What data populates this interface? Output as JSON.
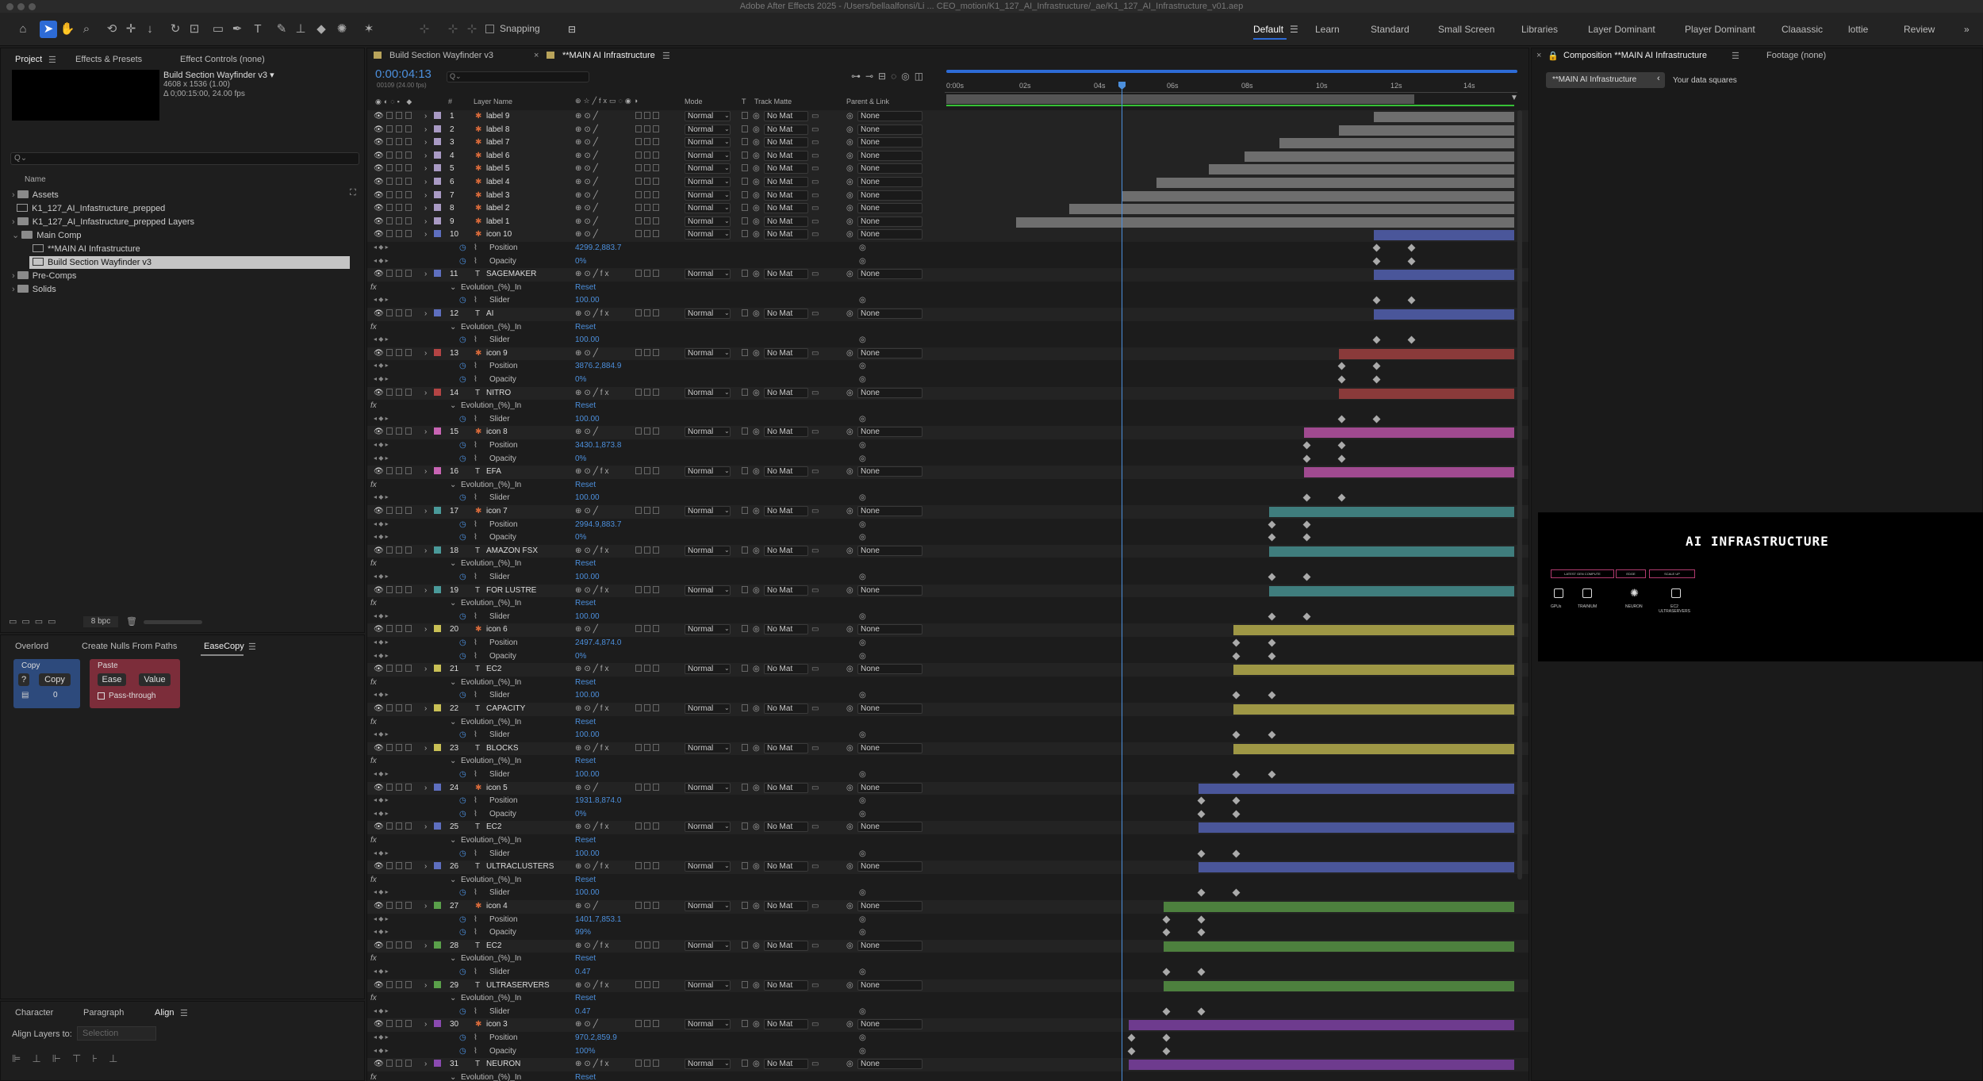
{
  "app": {
    "title": "Adobe After Effects 2025 - /Users/bellaalfonsi/Li ... CEO_motion/K1_127_AI_Infrastructure/_ae/K1_127_AI_Infrastructure_v01.aep",
    "snapping": "Snapping"
  },
  "workspaces": [
    "Default",
    "Learn",
    "Standard",
    "Small Screen",
    "Libraries",
    "Layer Dominant",
    "Player Dominant",
    "Claaassic",
    "lottie",
    "Review"
  ],
  "project": {
    "tabs": [
      "Project",
      "Effects & Presets",
      "Effect Controls (none)"
    ],
    "selected_name": "Build Section Wayfinder v3 ▾",
    "selected_info1": "4608 x 1536 (1.00)",
    "selected_info2": "Δ 0;00:15:00, 24.00 fps",
    "search_placeholder": "Q⌄",
    "name_header": "Name",
    "items": [
      "Assets",
      "K1_127_AI_Infastructure_prepped",
      "K1_127_AI_Infastructure_prepped Layers",
      "Main Comp",
      "**MAIN AI Infrastructure",
      "Build Section Wayfinder v3",
      "Pre-Comps",
      "Solids"
    ],
    "bpc": "8 bpc"
  },
  "scripts": {
    "tabs": [
      "Overlord",
      "Create Nulls From Paths",
      "EaseCopy"
    ],
    "copy_label": "Copy",
    "paste_label": "Paste",
    "q": "?",
    "copy_btn": "Copy",
    "ease_btn": "Ease",
    "value_btn": "Value",
    "count": "0",
    "passthrough": "Pass-through"
  },
  "align": {
    "tabs": [
      "Character",
      "Paragraph",
      "Align"
    ],
    "label": "Align Layers to:",
    "select": "Selection"
  },
  "timeline": {
    "tabs": [
      "Build Section Wayfinder v3",
      "**MAIN AI Infrastructure"
    ],
    "timecode": "0:00:04:13",
    "frames": "00109 (24.00 fps)",
    "headers": {
      "num": "#",
      "name": "Layer Name",
      "mode": "Mode",
      "t": "T",
      "matte": "Track Matte",
      "parent": "Parent & Link"
    },
    "ruler": [
      "0:00s",
      "02s",
      "04s",
      "06s",
      "08s",
      "10s",
      "12s",
      "14s"
    ],
    "rows": [
      {
        "t": "L",
        "n": "1",
        "name": "label 9",
        "c": "#a99ac4",
        "s": 1.22,
        "mode": "Normal",
        "matte": "No Mat",
        "parent": "None",
        "bar": "#6e6e6e"
      },
      {
        "t": "L",
        "n": "2",
        "name": "label 8",
        "c": "#a99ac4",
        "s": 1.12,
        "mode": "Normal",
        "matte": "No Mat",
        "parent": "None",
        "bar": "#6e6e6e"
      },
      {
        "t": "L",
        "n": "3",
        "name": "label 7",
        "c": "#a99ac4",
        "s": 0.95,
        "mode": "Normal",
        "matte": "No Mat",
        "parent": "None",
        "bar": "#6e6e6e"
      },
      {
        "t": "L",
        "n": "4",
        "name": "label 6",
        "c": "#a99ac4",
        "s": 0.85,
        "mode": "Normal",
        "matte": "No Mat",
        "parent": "None",
        "bar": "#6e6e6e"
      },
      {
        "t": "L",
        "n": "5",
        "name": "label 5",
        "c": "#a99ac4",
        "s": 0.75,
        "mode": "Normal",
        "matte": "No Mat",
        "parent": "None",
        "bar": "#6e6e6e"
      },
      {
        "t": "L",
        "n": "6",
        "name": "label 4",
        "c": "#a99ac4",
        "s": 0.6,
        "mode": "Normal",
        "matte": "No Mat",
        "parent": "None",
        "bar": "#6e6e6e"
      },
      {
        "t": "L",
        "n": "7",
        "name": "label 3",
        "c": "#a99ac4",
        "s": 0.5,
        "mode": "Normal",
        "matte": "No Mat",
        "parent": "None",
        "bar": "#6e6e6e"
      },
      {
        "t": "L",
        "n": "8",
        "name": "label 2",
        "c": "#a99ac4",
        "s": 0.35,
        "mode": "Normal",
        "matte": "No Mat",
        "parent": "None",
        "bar": "#6e6e6e"
      },
      {
        "t": "L",
        "n": "9",
        "name": "label 1",
        "c": "#a99ac4",
        "s": 0.2,
        "mode": "Normal",
        "matte": "No Mat",
        "parent": "None",
        "bar": "#6e6e6e"
      },
      {
        "t": "L",
        "n": "10",
        "name": "icon 10",
        "c": "#5e6fbf",
        "s": 1.22,
        "mode": "Normal",
        "matte": "No Mat",
        "parent": "None",
        "bar": "#4a569a"
      },
      {
        "t": "P",
        "name": "Position",
        "val": "4299.2,883.7",
        "k": [
          1.22,
          1.32
        ]
      },
      {
        "t": "P",
        "name": "Opacity",
        "val": "0%",
        "k": [
          1.22,
          1.32
        ]
      },
      {
        "t": "L",
        "n": "11",
        "name": "SAGEMAKER",
        "c": "#5e6fbf",
        "s": 1.22,
        "mode": "Normal",
        "matte": "No Mat",
        "parent": "None",
        "bar": "#4a569a",
        "tx": 1
      },
      {
        "t": "E",
        "name": "Evolution_(%)_In",
        "val": "Reset"
      },
      {
        "t": "P",
        "name": "Slider",
        "val": "100.00",
        "k": [
          1.22,
          1.32
        ]
      },
      {
        "t": "L",
        "n": "12",
        "name": "AI",
        "c": "#5e6fbf",
        "s": 1.22,
        "mode": "Normal",
        "matte": "No Mat",
        "parent": "None",
        "bar": "#4a569a",
        "tx": 1
      },
      {
        "t": "E",
        "name": "Evolution_(%)_In",
        "val": "Reset"
      },
      {
        "t": "P",
        "name": "Slider",
        "val": "100.00",
        "k": [
          1.22,
          1.32
        ]
      },
      {
        "t": "L",
        "n": "13",
        "name": "icon 9",
        "c": "#b34444",
        "s": 1.12,
        "mode": "Normal",
        "matte": "No Mat",
        "parent": "None",
        "bar": "#8a3a3a"
      },
      {
        "t": "P",
        "name": "Position",
        "val": "3876.2,884.9",
        "k": [
          1.12,
          1.22
        ]
      },
      {
        "t": "P",
        "name": "Opacity",
        "val": "0%",
        "k": [
          1.12,
          1.22
        ]
      },
      {
        "t": "L",
        "n": "14",
        "name": "NITRO",
        "c": "#b34444",
        "s": 1.12,
        "mode": "Normal",
        "matte": "No Mat",
        "parent": "None",
        "bar": "#8a3a3a",
        "tx": 1
      },
      {
        "t": "E",
        "name": "Evolution_(%)_In",
        "val": "Reset"
      },
      {
        "t": "P",
        "name": "Slider",
        "val": "100.00",
        "k": [
          1.12,
          1.22
        ]
      },
      {
        "t": "L",
        "n": "15",
        "name": "icon 8",
        "c": "#c864b4",
        "s": 1.02,
        "mode": "Normal",
        "matte": "No Mat",
        "parent": "None",
        "bar": "#a04a90"
      },
      {
        "t": "P",
        "name": "Position",
        "val": "3430.1,873.8",
        "k": [
          1.02,
          1.12
        ]
      },
      {
        "t": "P",
        "name": "Opacity",
        "val": "0%",
        "k": [
          1.02,
          1.12
        ]
      },
      {
        "t": "L",
        "n": "16",
        "name": "EFA",
        "c": "#c864b4",
        "s": 1.02,
        "mode": "Normal",
        "matte": "No Mat",
        "parent": "None",
        "bar": "#a04a90",
        "tx": 1
      },
      {
        "t": "E",
        "name": "Evolution_(%)_In",
        "val": "Reset"
      },
      {
        "t": "P",
        "name": "Slider",
        "val": "100.00",
        "k": [
          1.02,
          1.12
        ]
      },
      {
        "t": "L",
        "n": "17",
        "name": "icon 7",
        "c": "#4a9a9a",
        "s": 0.92,
        "mode": "Normal",
        "matte": "No Mat",
        "parent": "None",
        "bar": "#3f7d7d"
      },
      {
        "t": "P",
        "name": "Position",
        "val": "2994.9,883.7",
        "k": [
          0.92,
          1.02
        ]
      },
      {
        "t": "P",
        "name": "Opacity",
        "val": "0%",
        "k": [
          0.92,
          1.02
        ]
      },
      {
        "t": "L",
        "n": "18",
        "name": "AMAZON FSX",
        "c": "#4a9a9a",
        "s": 0.92,
        "mode": "Normal",
        "matte": "No Mat",
        "parent": "None",
        "bar": "#3f7d7d",
        "tx": 1
      },
      {
        "t": "E",
        "name": "Evolution_(%)_In",
        "val": "Reset"
      },
      {
        "t": "P",
        "name": "Slider",
        "val": "100.00",
        "k": [
          0.92,
          1.02
        ]
      },
      {
        "t": "L",
        "n": "19",
        "name": "FOR LUSTRE",
        "c": "#4a9a9a",
        "s": 0.92,
        "mode": "Normal",
        "matte": "No Mat",
        "parent": "None",
        "bar": "#3f7d7d",
        "tx": 1
      },
      {
        "t": "E",
        "name": "Evolution_(%)_In",
        "val": "Reset"
      },
      {
        "t": "P",
        "name": "Slider",
        "val": "100.00",
        "k": [
          0.92,
          1.02
        ]
      },
      {
        "t": "L",
        "n": "20",
        "name": "icon 6",
        "c": "#c9c055",
        "s": 0.82,
        "mode": "Normal",
        "matte": "No Mat",
        "parent": "None",
        "bar": "#9e9745"
      },
      {
        "t": "P",
        "name": "Position",
        "val": "2497.4,874.0",
        "k": [
          0.82,
          0.92
        ]
      },
      {
        "t": "P",
        "name": "Opacity",
        "val": "0%",
        "k": [
          0.82,
          0.92
        ]
      },
      {
        "t": "L",
        "n": "21",
        "name": "EC2",
        "c": "#c9c055",
        "s": 0.82,
        "mode": "Normal",
        "matte": "No Mat",
        "parent": "None",
        "bar": "#9e9745",
        "tx": 1
      },
      {
        "t": "E",
        "name": "Evolution_(%)_In",
        "val": "Reset"
      },
      {
        "t": "P",
        "name": "Slider",
        "val": "100.00",
        "k": [
          0.82,
          0.92
        ]
      },
      {
        "t": "L",
        "n": "22",
        "name": "CAPACITY",
        "c": "#c9c055",
        "s": 0.82,
        "mode": "Normal",
        "matte": "No Mat",
        "parent": "None",
        "bar": "#9e9745",
        "tx": 1
      },
      {
        "t": "E",
        "name": "Evolution_(%)_In",
        "val": "Reset"
      },
      {
        "t": "P",
        "name": "Slider",
        "val": "100.00",
        "k": [
          0.82,
          0.92
        ]
      },
      {
        "t": "L",
        "n": "23",
        "name": "BLOCKS",
        "c": "#c9c055",
        "s": 0.82,
        "mode": "Normal",
        "matte": "No Mat",
        "parent": "None",
        "bar": "#9e9745",
        "tx": 1
      },
      {
        "t": "E",
        "name": "Evolution_(%)_In",
        "val": "Reset"
      },
      {
        "t": "P",
        "name": "Slider",
        "val": "100.00",
        "k": [
          0.82,
          0.92
        ]
      },
      {
        "t": "L",
        "n": "24",
        "name": "icon 5",
        "c": "#5e6fbf",
        "s": 0.72,
        "mode": "Normal",
        "matte": "No Mat",
        "parent": "None",
        "bar": "#4a569a"
      },
      {
        "t": "P",
        "name": "Position",
        "val": "1931.8,874.0",
        "k": [
          0.72,
          0.82
        ]
      },
      {
        "t": "P",
        "name": "Opacity",
        "val": "0%",
        "k": [
          0.72,
          0.82
        ]
      },
      {
        "t": "L",
        "n": "25",
        "name": "EC2",
        "c": "#5e6fbf",
        "s": 0.72,
        "mode": "Normal",
        "matte": "No Mat",
        "parent": "None",
        "bar": "#4a569a",
        "tx": 1
      },
      {
        "t": "E",
        "name": "Evolution_(%)_In",
        "val": "Reset"
      },
      {
        "t": "P",
        "name": "Slider",
        "val": "100.00",
        "k": [
          0.72,
          0.82
        ]
      },
      {
        "t": "L",
        "n": "26",
        "name": "ULTRACLUSTERS",
        "c": "#5e6fbf",
        "s": 0.72,
        "mode": "Normal",
        "matte": "No Mat",
        "parent": "None",
        "bar": "#4a569a",
        "tx": 1
      },
      {
        "t": "E",
        "name": "Evolution_(%)_In",
        "val": "Reset"
      },
      {
        "t": "P",
        "name": "Slider",
        "val": "100.00",
        "k": [
          0.72,
          0.82
        ]
      },
      {
        "t": "L",
        "n": "27",
        "name": "icon 4",
        "c": "#5aa04a",
        "s": 0.62,
        "mode": "Normal",
        "matte": "No Mat",
        "parent": "None",
        "bar": "#4d803e"
      },
      {
        "t": "P",
        "name": "Position",
        "val": "1401.7,853.1",
        "k": [
          0.62,
          0.72
        ]
      },
      {
        "t": "P",
        "name": "Opacity",
        "val": "99%",
        "k": [
          0.62,
          0.72
        ]
      },
      {
        "t": "L",
        "n": "28",
        "name": "EC2",
        "c": "#5aa04a",
        "s": 0.62,
        "mode": "Normal",
        "matte": "No Mat",
        "parent": "None",
        "bar": "#4d803e",
        "tx": 1
      },
      {
        "t": "E",
        "name": "Evolution_(%)_In",
        "val": "Reset"
      },
      {
        "t": "P",
        "name": "Slider",
        "val": "0.47",
        "k": [
          0.62,
          0.72
        ]
      },
      {
        "t": "L",
        "n": "29",
        "name": "ULTRASERVERS",
        "c": "#5aa04a",
        "s": 0.62,
        "mode": "Normal",
        "matte": "No Mat",
        "parent": "None",
        "bar": "#4d803e",
        "tx": 1
      },
      {
        "t": "E",
        "name": "Evolution_(%)_In",
        "val": "Reset"
      },
      {
        "t": "P",
        "name": "Slider",
        "val": "0.47",
        "k": [
          0.62,
          0.72
        ]
      },
      {
        "t": "L",
        "n": "30",
        "name": "icon 3",
        "c": "#8a4ab0",
        "s": 0.52,
        "mode": "Normal",
        "matte": "No Mat",
        "parent": "None",
        "bar": "#6e3b8e"
      },
      {
        "t": "P",
        "name": "Position",
        "val": "970.2,859.9",
        "k": [
          0.52,
          0.62
        ]
      },
      {
        "t": "P",
        "name": "Opacity",
        "val": "100%",
        "k": [
          0.52,
          0.62
        ]
      },
      {
        "t": "L",
        "n": "31",
        "name": "NEURON",
        "c": "#8a4ab0",
        "s": 0.52,
        "mode": "Normal",
        "matte": "No Mat",
        "parent": "None",
        "bar": "#6e3b8e",
        "tx": 1
      },
      {
        "t": "E",
        "name": "Evolution_(%)_In",
        "val": "Reset"
      }
    ]
  },
  "composition": {
    "tab": "Composition **MAIN AI Infrastructure",
    "footage": "Footage (none)",
    "crumb1": "**MAIN AI Infrastructure",
    "crumb2": "Your data squares",
    "preview_title": "AI INFRASTRUCTURE",
    "preview_boxes": [
      "LATEST GEN COMPUTE",
      "EDGE",
      "SCALE UP"
    ],
    "preview_labels": [
      "GPUs",
      "TRAINIUM",
      "NEURON",
      "EC2 ULTRASERVERS"
    ]
  }
}
